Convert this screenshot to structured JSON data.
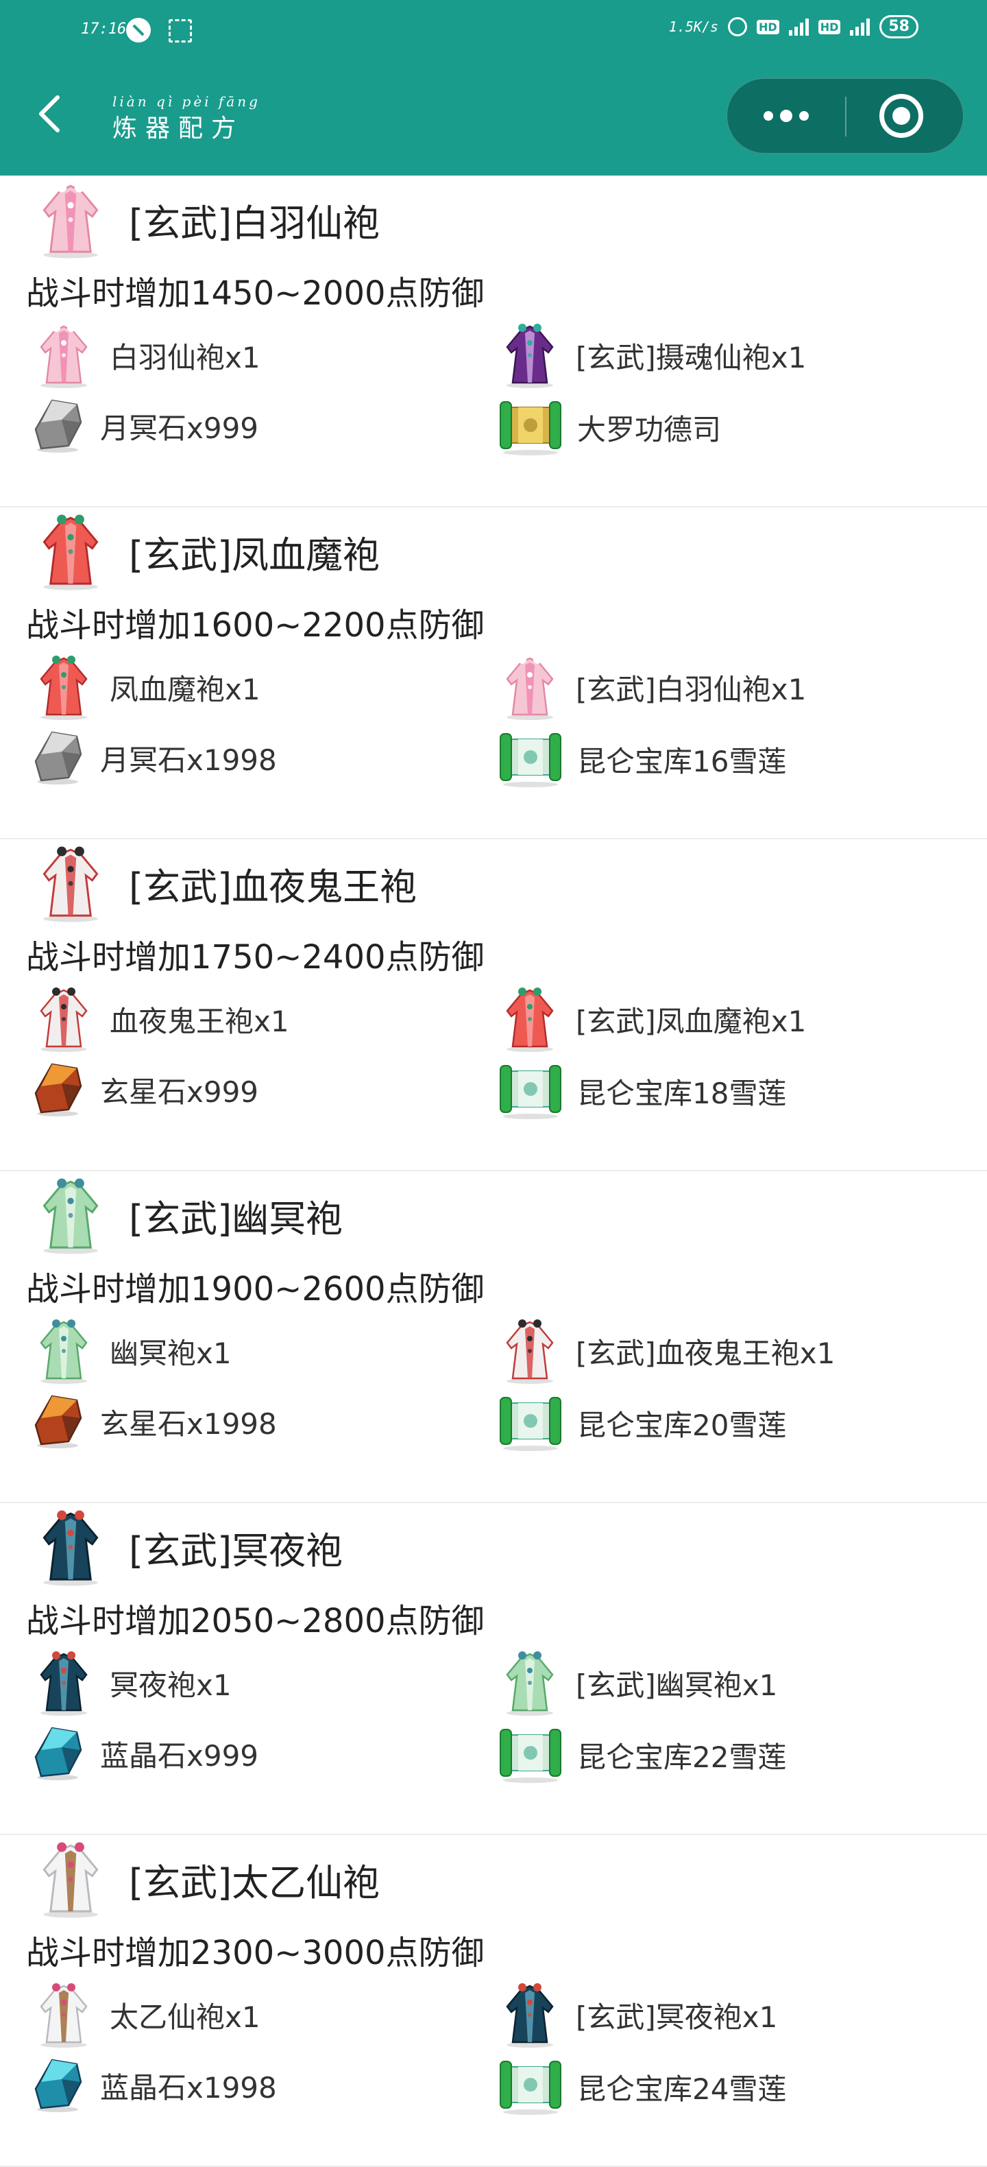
{
  "status_bar": {
    "time": "17:16",
    "net_speed": "1.5K/s",
    "hd1": "HD",
    "hd2": "HD",
    "battery": "58"
  },
  "nav": {
    "pinyin": "liàn qì pèi fāng",
    "title": "炼器配方",
    "back_icon": "chevron-left-icon",
    "more_icon": "more-dots-icon",
    "close_icon": "target-close-icon"
  },
  "recipes": [
    {
      "name": "[玄武]白羽仙袍",
      "icon": "robe-pink",
      "effect": "战斗时增加1450~2000点防御",
      "materials": [
        {
          "label": "白羽仙袍x1",
          "icon": "robe-pink"
        },
        {
          "label": "[玄武]摄魂仙袍x1",
          "icon": "robe-purple"
        },
        {
          "label": "月冥石x999",
          "icon": "stone-gray"
        },
        {
          "label": "大罗功德司",
          "icon": "scroll-gold"
        }
      ]
    },
    {
      "name": "[玄武]凤血魔袍",
      "icon": "robe-red",
      "effect": "战斗时增加1600~2200点防御",
      "materials": [
        {
          "label": "凤血魔袍x1",
          "icon": "robe-red"
        },
        {
          "label": "[玄武]白羽仙袍x1",
          "icon": "robe-pink"
        },
        {
          "label": "月冥石x1998",
          "icon": "stone-gray"
        },
        {
          "label": "昆仑宝库16雪莲",
          "icon": "scroll-green"
        }
      ]
    },
    {
      "name": "[玄武]血夜鬼王袍",
      "icon": "robe-ghost",
      "effect": "战斗时增加1750~2400点防御",
      "materials": [
        {
          "label": "血夜鬼王袍x1",
          "icon": "robe-ghost"
        },
        {
          "label": "[玄武]凤血魔袍x1",
          "icon": "robe-red"
        },
        {
          "label": "玄星石x999",
          "icon": "stone-orange"
        },
        {
          "label": "昆仑宝库18雪莲",
          "icon": "scroll-green"
        }
      ]
    },
    {
      "name": "[玄武]幽冥袍",
      "icon": "robe-green",
      "effect": "战斗时增加1900~2600点防御",
      "materials": [
        {
          "label": "幽冥袍x1",
          "icon": "robe-green"
        },
        {
          "label": "[玄武]血夜鬼王袍x1",
          "icon": "robe-ghost"
        },
        {
          "label": "玄星石x1998",
          "icon": "stone-orange"
        },
        {
          "label": "昆仑宝库20雪莲",
          "icon": "scroll-green"
        }
      ]
    },
    {
      "name": "[玄武]冥夜袍",
      "icon": "robe-dark",
      "effect": "战斗时增加2050~2800点防御",
      "materials": [
        {
          "label": "冥夜袍x1",
          "icon": "robe-dark"
        },
        {
          "label": "[玄武]幽冥袍x1",
          "icon": "robe-green"
        },
        {
          "label": "蓝晶石x999",
          "icon": "stone-blue"
        },
        {
          "label": "昆仑宝库22雪莲",
          "icon": "scroll-green"
        }
      ]
    },
    {
      "name": "[玄武]太乙仙袍",
      "icon": "robe-white",
      "effect": "战斗时增加2300~3000点防御",
      "materials": [
        {
          "label": "太乙仙袍x1",
          "icon": "robe-white"
        },
        {
          "label": "[玄武]冥夜袍x1",
          "icon": "robe-dark"
        },
        {
          "label": "蓝晶石x1998",
          "icon": "stone-blue"
        },
        {
          "label": "昆仑宝库24雪莲",
          "icon": "scroll-green"
        }
      ]
    }
  ],
  "colors": {
    "header_bg": "#199c8c",
    "capsule_bg": "#0d6e63",
    "text": "#222222",
    "divider": "#ececec"
  }
}
